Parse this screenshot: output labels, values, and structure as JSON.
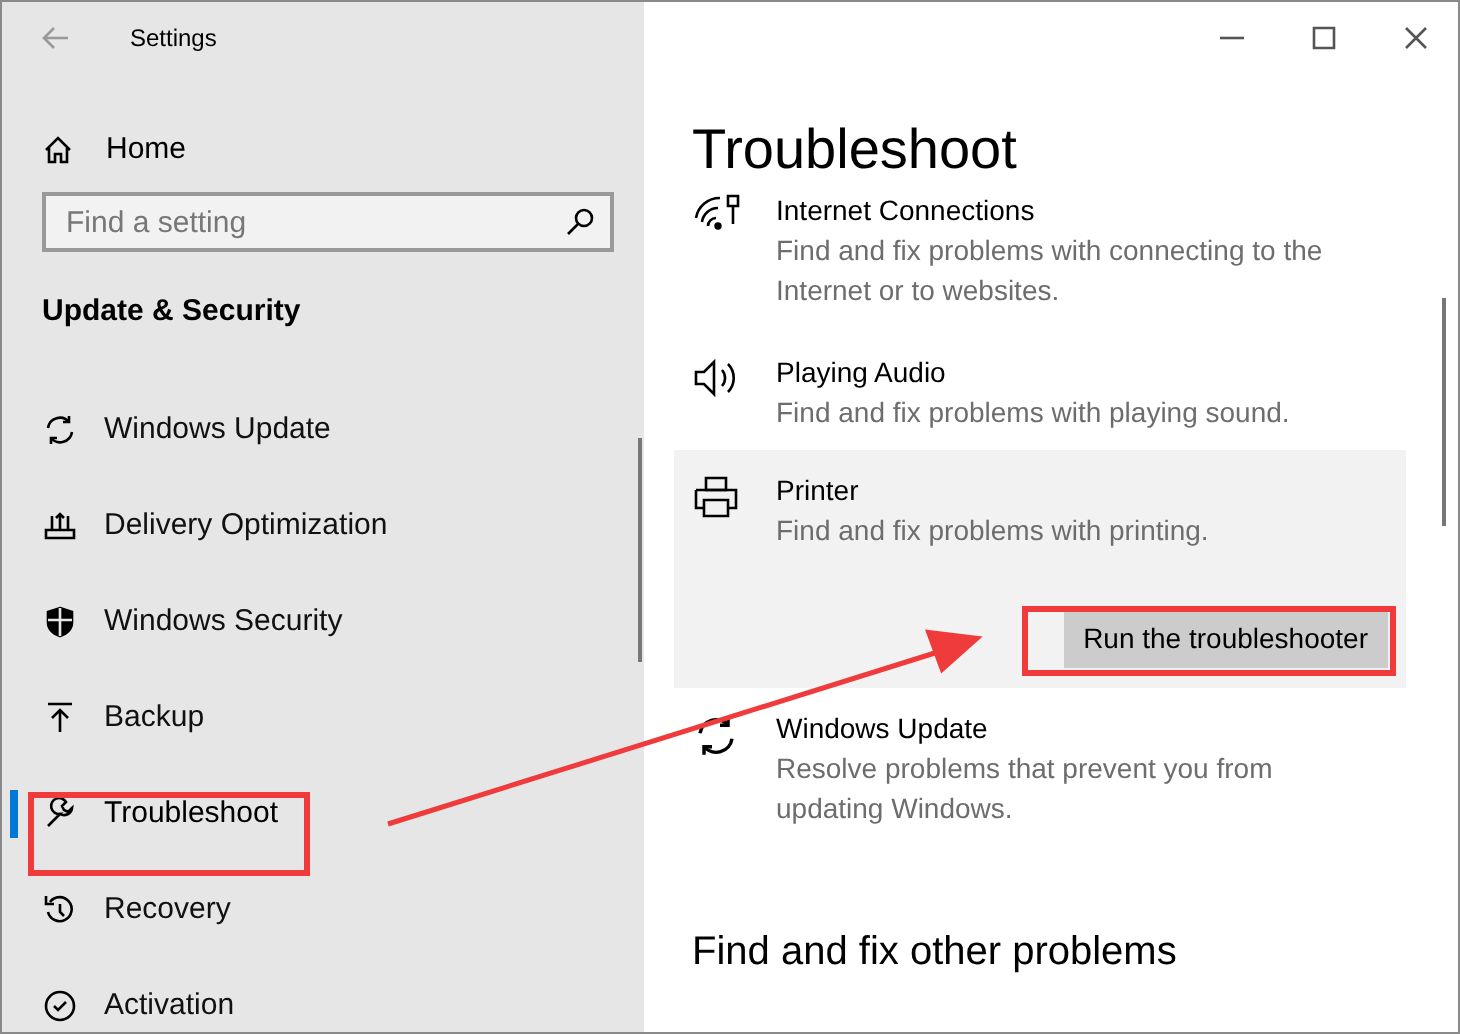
{
  "window": {
    "title": "Settings"
  },
  "sidebar": {
    "home": "Home",
    "search": {
      "placeholder": "Find a setting"
    },
    "section": "Update & Security",
    "items": [
      {
        "label": "Windows Update",
        "selected": false
      },
      {
        "label": "Delivery Optimization",
        "selected": false
      },
      {
        "label": "Windows Security",
        "selected": false
      },
      {
        "label": "Backup",
        "selected": false
      },
      {
        "label": "Troubleshoot",
        "selected": true
      },
      {
        "label": "Recovery",
        "selected": false
      },
      {
        "label": "Activation",
        "selected": false
      }
    ]
  },
  "main": {
    "title": "Troubleshoot",
    "troubleshooters": [
      {
        "title": "Internet Connections",
        "description": "Find and fix problems with connecting to the Internet or to websites.",
        "expanded": false
      },
      {
        "title": "Playing Audio",
        "description": "Find and fix problems with playing sound.",
        "expanded": false
      },
      {
        "title": "Printer",
        "description": "Find and fix problems with printing.",
        "expanded": true,
        "button": "Run the troubleshooter"
      },
      {
        "title": "Windows Update",
        "description": "Resolve problems that prevent you from updating Windows.",
        "expanded": false
      }
    ],
    "section": "Find and fix other problems"
  },
  "annotations": [
    {
      "kind": "highlight-box"
    },
    {
      "kind": "highlight-box"
    },
    {
      "kind": "arrow"
    }
  ]
}
